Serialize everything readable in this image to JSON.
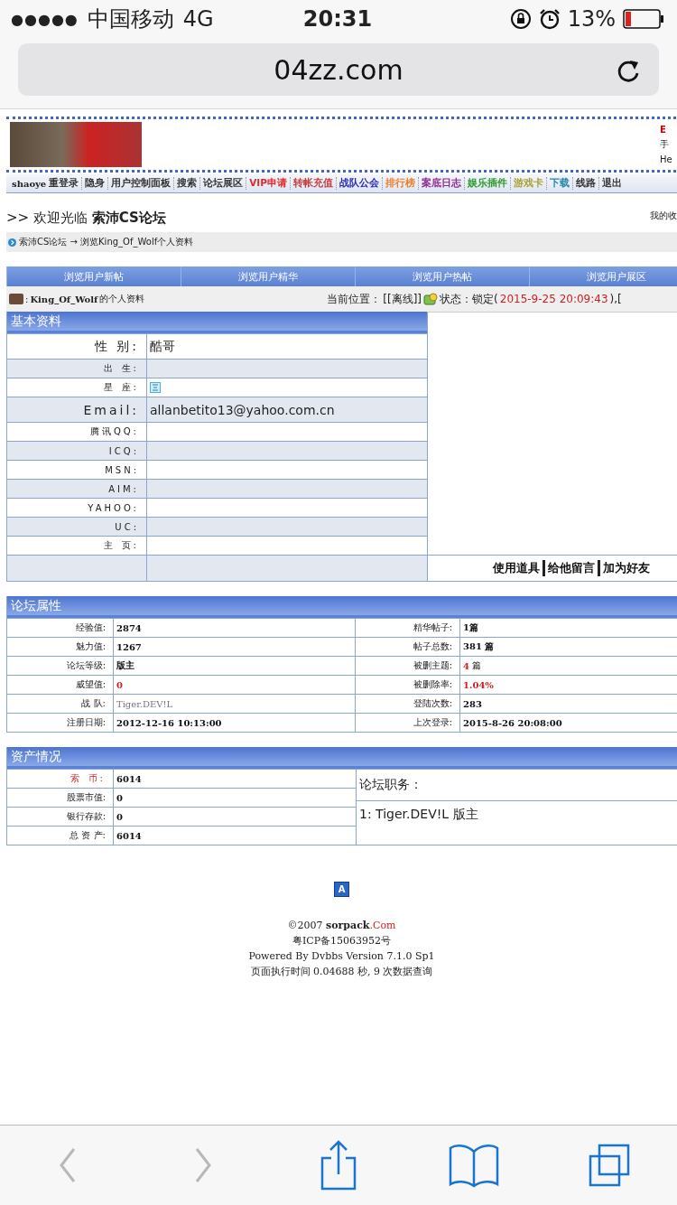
{
  "status_bar": {
    "signal": "●●●●●",
    "carrier": "中国移动",
    "network": "4G",
    "time": "20:31",
    "battery": "13%"
  },
  "address_bar": {
    "url": "04zz.com"
  },
  "site_header": {
    "right_lines": [
      "E",
      "手",
      "He"
    ]
  },
  "nav": {
    "user": "shaoye",
    "items": [
      {
        "label": "重登录",
        "color": "#333333"
      },
      {
        "label": "隐身",
        "color": "#333333"
      },
      {
        "label": "用户控制面板",
        "color": "#333333"
      },
      {
        "label": "搜索",
        "color": "#333333"
      },
      {
        "label": "论坛展区",
        "color": "#333333"
      },
      {
        "label": "VIP申请",
        "color": "#e02a2a"
      },
      {
        "label": "转帐充值",
        "color": "#c83a3a"
      },
      {
        "label": "战队公会",
        "color": "#2a2ab8"
      },
      {
        "label": "排行榜",
        "color": "#ee7a22"
      },
      {
        "label": "案底日志",
        "color": "#8e2a8e"
      },
      {
        "label": "娱乐插件",
        "color": "#2a9a2a"
      },
      {
        "label": "游戏卡",
        "color": "#a8a030"
      },
      {
        "label": "下载",
        "color": "#2a86a8"
      },
      {
        "label": "线路",
        "color": "#333333"
      },
      {
        "label": "退出",
        "color": "#333333"
      }
    ]
  },
  "welcome": {
    "text": ">> 欢迎光临 **索沛CS论坛**",
    "right": "我的收"
  },
  "breadcrumb": "索沛CS论坛 → 浏览King_Of_Wolf个人资料",
  "user_tabs": [
    "浏览用户新帖",
    "浏览用户精华",
    "浏览用户热帖",
    "浏览用户展区"
  ],
  "profile_line": {
    "separator": ":",
    "username": "King_Of_Wolf",
    "suffix": "的个人资料",
    "location_label": "当前位置：",
    "location": "[[离线]]",
    "status_label": "状态：锁定(",
    "status_time": "2015-9-25 20:09:43",
    "status_tail": "),["
  },
  "basic_info": {
    "title": "基本资料",
    "rows": [
      {
        "label": "性 别:",
        "kind": "text",
        "value": "酷哥"
      },
      {
        "label": "出 生:",
        "kind": "empty"
      },
      {
        "label": "星 座:",
        "kind": "icon"
      },
      {
        "label": "Email:",
        "kind": "text",
        "value": "allanbetito13@yahoo.com.cn"
      },
      {
        "label": "腾讯QQ:",
        "kind": "empty"
      },
      {
        "label": "ICQ:",
        "kind": "empty"
      },
      {
        "label": "MSN:",
        "kind": "empty"
      },
      {
        "label": "AIM:",
        "kind": "empty"
      },
      {
        "label": "YAHOO:",
        "kind": "empty"
      },
      {
        "label": "UC:",
        "kind": "empty"
      },
      {
        "label": "主 页:",
        "kind": "empty"
      }
    ],
    "actions": [
      "使用道具",
      "给他留言",
      "加为好友"
    ]
  },
  "forum_attrs": {
    "title": "论坛属性",
    "rows": [
      [
        {
          "label": "经验值:",
          "value": "2874",
          "kind": "plain"
        },
        {
          "label": "精华帖子:",
          "value": "1篇",
          "kind": "plain"
        }
      ],
      [
        {
          "label": "魅力值:",
          "value": "1267",
          "kind": "plain"
        },
        {
          "label": "帖子总数:",
          "value": "381 篇",
          "kind": "plain"
        }
      ],
      [
        {
          "label": "论坛等级:",
          "value": "版主",
          "kind": "plain"
        },
        {
          "label": "被删主题:",
          "value": "4",
          "unit": "篇",
          "kind": "alert"
        }
      ],
      [
        {
          "label": "威望值:",
          "value": "0",
          "kind": "alert"
        },
        {
          "label": "被删除率:",
          "value": "1.04%",
          "kind": "alert"
        }
      ],
      [
        {
          "label": "战 队:",
          "value": "Tiger.DEV!L",
          "kind": "muted"
        },
        {
          "label": "登陆次数:",
          "value": "283",
          "kind": "plain"
        }
      ],
      [
        {
          "label": "注册日期:",
          "value": "2012-12-16 10:13:00",
          "kind": "plain"
        },
        {
          "label": "上次登录:",
          "value": "2015-8-26 20:08:00",
          "kind": "plain"
        }
      ]
    ]
  },
  "assets": {
    "title": "资产情况",
    "rows": [
      {
        "label": "索 币:",
        "value": "6014",
        "kind": "alert"
      },
      {
        "label": "股票市值:",
        "value": "0",
        "kind": "plain"
      },
      {
        "label": "银行存款:",
        "value": "0",
        "kind": "plain"
      },
      {
        "label": "总 资 产:",
        "value": "6014",
        "kind": "plain"
      }
    ],
    "duties_title": "论坛职务：",
    "duties": [
      "1: Tiger.DEV!L 版主"
    ]
  },
  "footer": {
    "badge": "A",
    "copyright": "©2007",
    "site": "sorpack",
    "domain": ".Com",
    "lines": [
      "粤ICP备15063952号",
      "Powered By Dvbbs Version 7.1.0 Sp1",
      "页面执行时间 0.04688 秒, 9 次数据查询"
    ]
  },
  "toolbar": [
    {
      "kind": "back",
      "disabled": true
    },
    {
      "kind": "forward",
      "disabled": true
    },
    {
      "kind": "share",
      "disabled": false
    },
    {
      "kind": "bookmarks",
      "disabled": false
    },
    {
      "kind": "tabs",
      "disabled": false
    }
  ]
}
